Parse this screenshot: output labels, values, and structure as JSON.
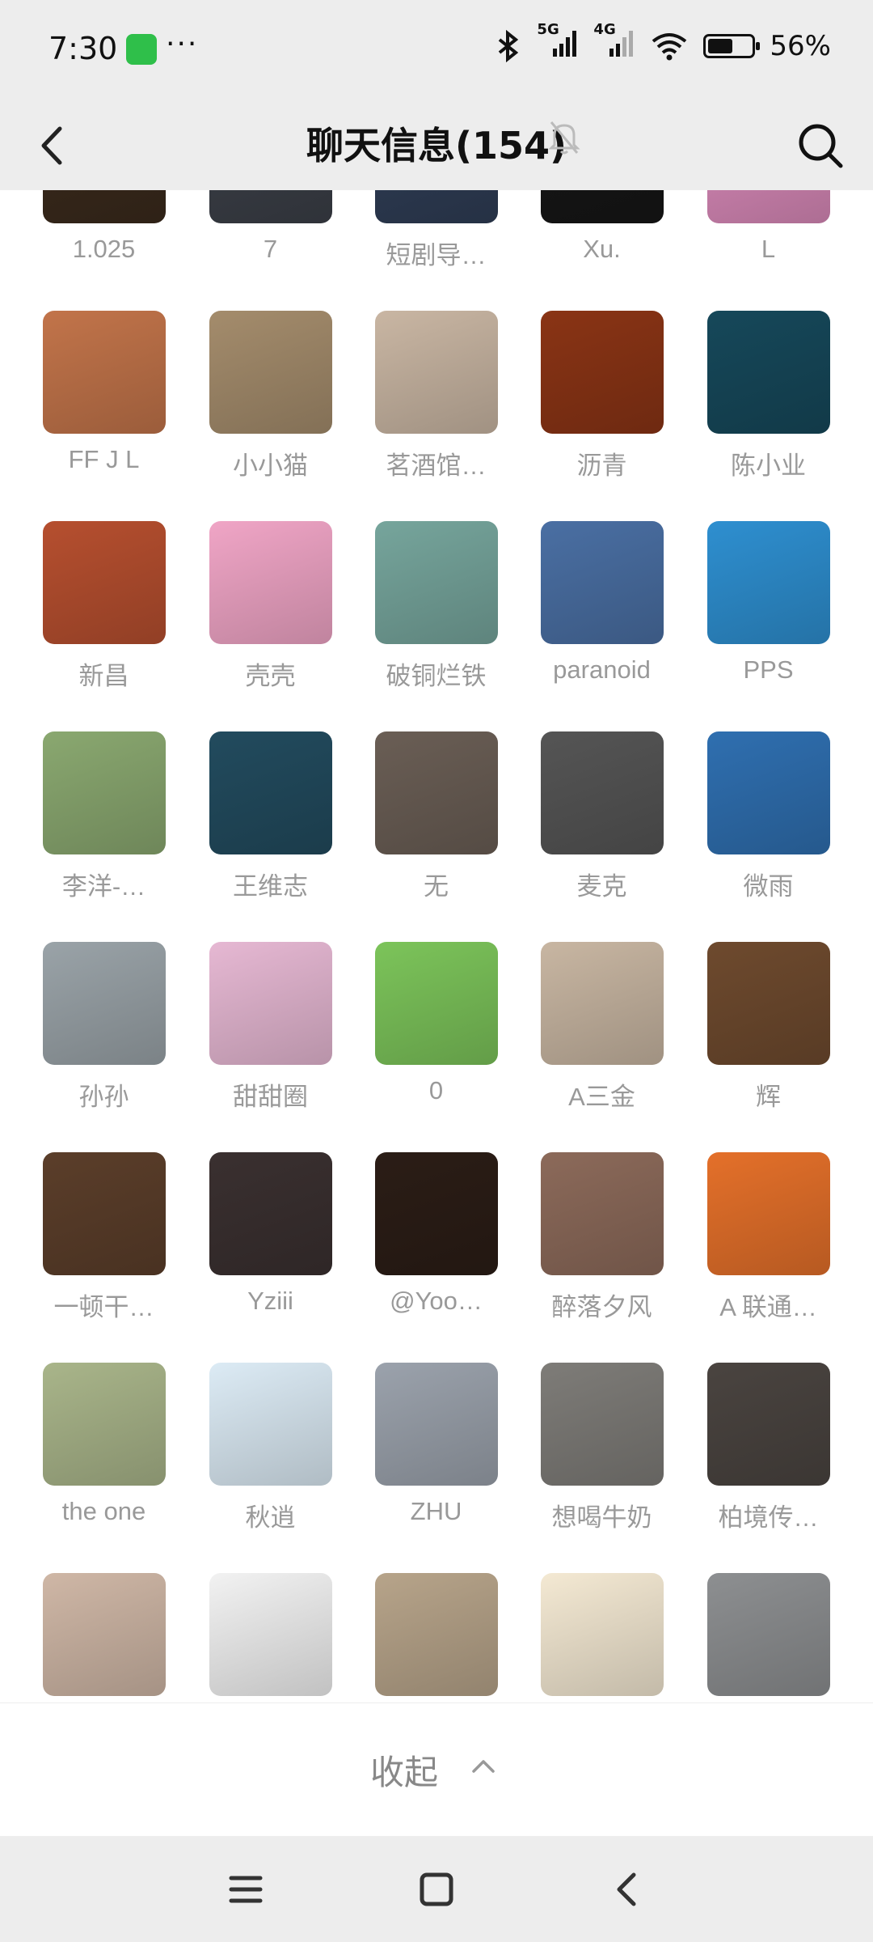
{
  "status": {
    "time": "7:30",
    "battery": "56%",
    "signal1": "5G",
    "signal2": "4G"
  },
  "header": {
    "title": "聊天信息(154)"
  },
  "members": [
    {
      "name": "1.025",
      "color": "#3a2a1c"
    },
    {
      "name": "7",
      "color": "#3b3f47"
    },
    {
      "name": "短剧导…",
      "color": "#2f3d55"
    },
    {
      "name": "Xu.",
      "color": "#161616"
    },
    {
      "name": "L",
      "color": "#d889b8"
    },
    {
      "name": "FF  J L",
      "color": "#c2744a"
    },
    {
      "name": "小小猫",
      "color": "#a48c6c"
    },
    {
      "name": "茗酒馆…",
      "color": "#c9b6a3"
    },
    {
      "name": "沥青",
      "color": "#8a3415"
    },
    {
      "name": "陈小业",
      "color": "#16485a"
    },
    {
      "name": "新昌",
      "color": "#b64f2f"
    },
    {
      "name": "壳壳",
      "color": "#f0a5c6"
    },
    {
      "name": "破铜烂铁",
      "color": "#76a59c"
    },
    {
      "name": "paranoid",
      "color": "#4a6fa3"
    },
    {
      "name": "PPS",
      "color": "#2e8fd0"
    },
    {
      "name": "李洋-…",
      "color": "#8aa870"
    },
    {
      "name": "王维志",
      "color": "#224b5e"
    },
    {
      "name": "无",
      "color": "#6a5e55"
    },
    {
      "name": "麦克",
      "color": "#555555"
    },
    {
      "name": "微雨",
      "color": "#2f6fb0"
    },
    {
      "name": "孙孙",
      "color": "#9aa3a8"
    },
    {
      "name": "甜甜圈",
      "color": "#e6b8d3"
    },
    {
      "name": "0",
      "color": "#7cc45a"
    },
    {
      "name": "A三金",
      "color": "#c8b6a2"
    },
    {
      "name": "辉",
      "color": "#6e4a2e"
    },
    {
      "name": "一顿干…",
      "color": "#5b3e2a"
    },
    {
      "name": "Yziii",
      "color": "#3a3030"
    },
    {
      "name": "@Yoo…",
      "color": "#2b1d16"
    },
    {
      "name": "醉落夕风",
      "color": "#8c6a5a"
    },
    {
      "name": "A 联通…",
      "color": "#e4702a"
    },
    {
      "name": "the one",
      "color": "#a9b58a"
    },
    {
      "name": "秋逍",
      "color": "#dcebf5"
    },
    {
      "name": "ZHU",
      "color": "#9ba2ac"
    },
    {
      "name": "想喝牛奶",
      "color": "#7e7c78"
    },
    {
      "name": "柏境传…",
      "color": "#4a4440"
    },
    {
      "name": "",
      "color": "#cfb7a6"
    },
    {
      "name": "",
      "color": "#f2f2f2"
    },
    {
      "name": "",
      "color": "#b7a48a"
    },
    {
      "name": "",
      "color": "#f4e9d3"
    },
    {
      "name": "",
      "color": "#8d8f91"
    }
  ],
  "collapse": {
    "label": "收起"
  }
}
